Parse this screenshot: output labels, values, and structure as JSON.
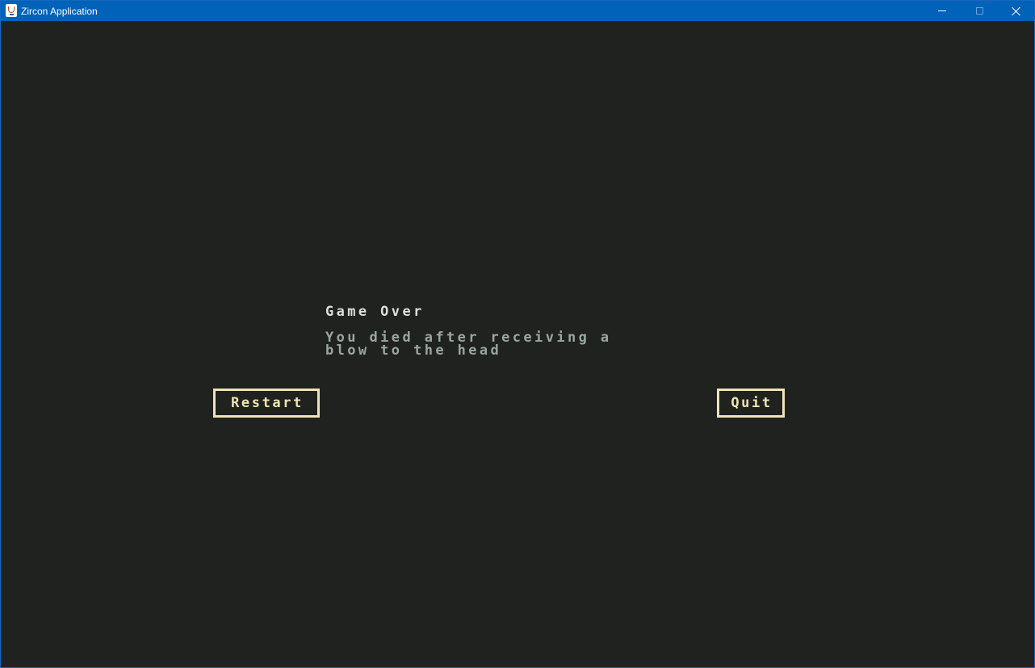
{
  "window": {
    "title": "Zircon Application",
    "icon": "java-cup-icon",
    "controls": [
      "minimize-icon",
      "maximize-icon",
      "close-icon"
    ]
  },
  "dialog": {
    "heading": "Game Over",
    "message_line1": "You died after receiving a",
    "message_line2": "blow to the head",
    "restart_label": "Restart",
    "quit_label": "Quit"
  },
  "colors": {
    "background": "#1f221f",
    "titlebar": "#0062b8",
    "heading_text": "#dedede",
    "message_text": "#9aa6a2",
    "button": "#f1e3b4"
  }
}
